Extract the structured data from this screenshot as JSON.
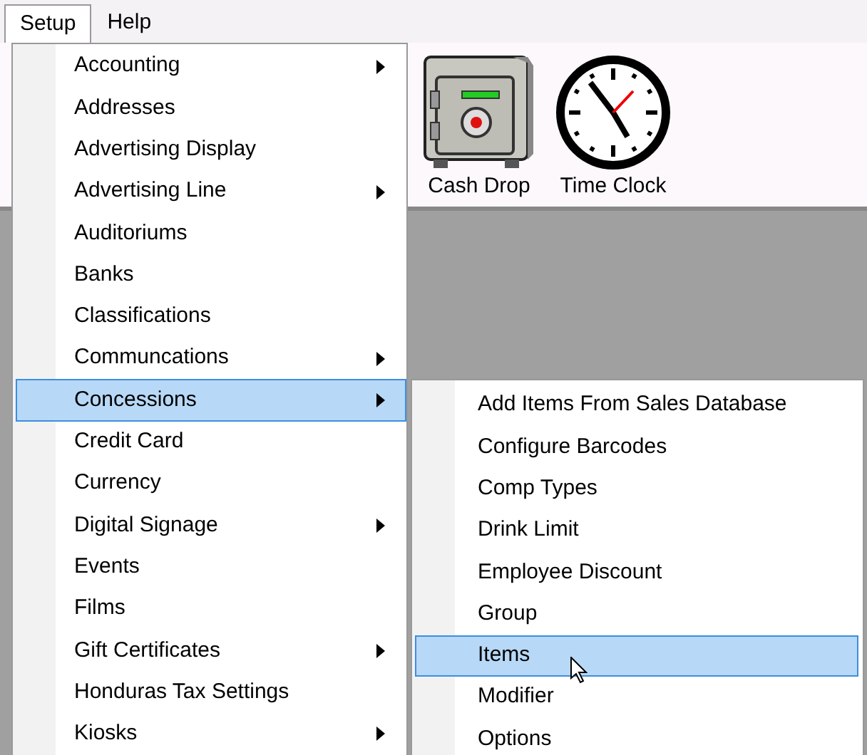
{
  "menu_bar": [
    {
      "label": "Setup",
      "selected": true
    },
    {
      "label": "Help",
      "selected": false
    }
  ],
  "toolbar": [
    {
      "label": "Cash Drop",
      "kind": "safe"
    },
    {
      "label": "Time Clock",
      "kind": "clock"
    }
  ],
  "setup_menu": [
    {
      "label": "Accounting",
      "submenu": true,
      "selected": false
    },
    {
      "label": "Addresses",
      "submenu": false,
      "selected": false
    },
    {
      "label": "Advertising Display",
      "submenu": false,
      "selected": false
    },
    {
      "label": "Advertising Line",
      "submenu": true,
      "selected": false
    },
    {
      "label": "Auditoriums",
      "submenu": false,
      "selected": false
    },
    {
      "label": "Banks",
      "submenu": false,
      "selected": false
    },
    {
      "label": "Classifications",
      "submenu": false,
      "selected": false
    },
    {
      "label": "Communcations",
      "submenu": true,
      "selected": false
    },
    {
      "label": "Concessions",
      "submenu": true,
      "selected": true
    },
    {
      "label": "Credit Card",
      "submenu": false,
      "selected": false
    },
    {
      "label": "Currency",
      "submenu": false,
      "selected": false
    },
    {
      "label": "Digital Signage",
      "submenu": true,
      "selected": false
    },
    {
      "label": "Events",
      "submenu": false,
      "selected": false
    },
    {
      "label": "Films",
      "submenu": false,
      "selected": false
    },
    {
      "label": "Gift Certificates",
      "submenu": true,
      "selected": false
    },
    {
      "label": "Honduras Tax Settings",
      "submenu": false,
      "selected": false
    },
    {
      "label": "Kiosks",
      "submenu": true,
      "selected": false
    }
  ],
  "concessions_menu": [
    {
      "label": "Add Items From Sales Database",
      "selected": false
    },
    {
      "label": "Configure Barcodes",
      "selected": false
    },
    {
      "label": "Comp Types",
      "selected": false
    },
    {
      "label": "Drink Limit",
      "selected": false
    },
    {
      "label": "Employee Discount",
      "selected": false
    },
    {
      "label": "Group",
      "selected": false
    },
    {
      "label": "Items",
      "selected": true
    },
    {
      "label": "Modifier",
      "selected": false
    },
    {
      "label": "Options",
      "selected": false
    }
  ]
}
